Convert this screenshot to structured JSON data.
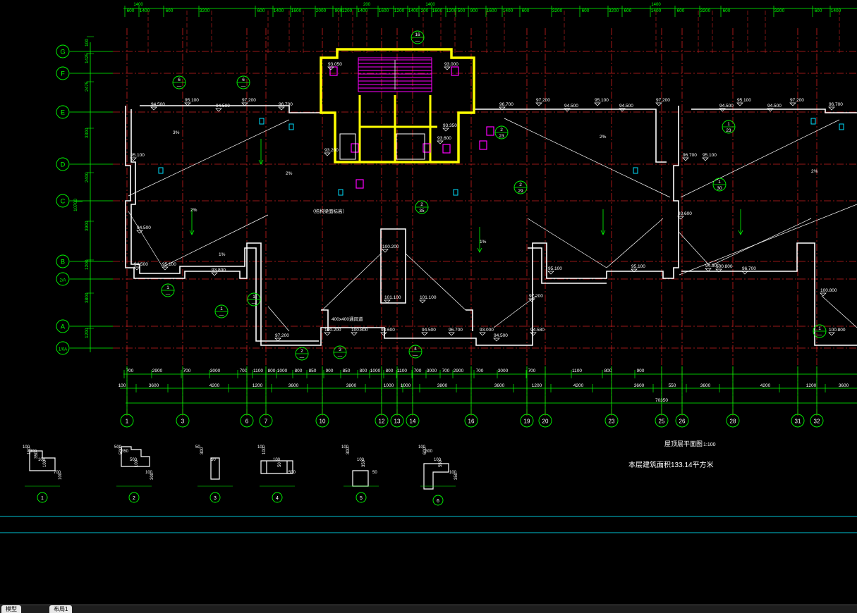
{
  "drawing": {
    "plan_title": "屋顶层平面图",
    "plan_scale": "1:100",
    "area_note": "本层建筑面积133.14平方米",
    "top_dims": [
      "600",
      "1400",
      "600",
      "3200",
      "600",
      "1400",
      "1600",
      "2000",
      "900",
      "1200",
      "1400",
      "1600",
      "1200",
      "1400",
      "200",
      "1600",
      "1200",
      "500",
      "900",
      "1600",
      "1400",
      "600",
      "3200",
      "600",
      "3200",
      "600",
      "1400",
      "600",
      "3200",
      "600",
      "3200",
      "600",
      "1400"
    ],
    "top_header_dims": [
      "1400",
      "200",
      "1400",
      "1400"
    ],
    "bottom_dims_1": [
      "700",
      "2900",
      "700",
      "3000",
      "700",
      "1100",
      "800",
      "1000",
      "800",
      "850",
      "900",
      "850",
      "800",
      "1000",
      "800",
      "1100",
      "700",
      "3000",
      "700",
      "2900",
      "700",
      "3000",
      "700",
      "1100",
      "800",
      "900"
    ],
    "bottom_dims_2": [
      "100",
      "3600",
      "4200",
      "1200",
      "3600",
      "3800",
      "1000",
      "1000",
      "3800",
      "3600",
      "1200",
      "4200",
      "3600",
      "550",
      "3600",
      "4200",
      "1200",
      "3600"
    ],
    "overall_dim": "70350",
    "col_axes": [
      "1",
      "3",
      "6",
      "7",
      "10",
      "12",
      "13",
      "14",
      "16",
      "19",
      "20",
      "23",
      "25",
      "26",
      "28",
      "31",
      "32"
    ],
    "row_axes": [
      "G",
      "F",
      "E",
      "D",
      "C",
      "B",
      "2/A",
      "A",
      "1/0A"
    ],
    "row_dims": [
      "100",
      "1425",
      "2475",
      "3300",
      "2400",
      "3900",
      "1200",
      "3800",
      "1200",
      "10700"
    ],
    "elevations": [
      "94.500",
      "95.100",
      "94.500",
      "97.200",
      "96.700",
      "95.100",
      "94.500",
      "95.100",
      "93.800",
      "93.050",
      "93.000",
      "93.350",
      "93.600",
      "93.200",
      "96.700",
      "97.200",
      "94.500",
      "95.100",
      "94.500",
      "97.200",
      "96.700",
      "95.100",
      "94.500",
      "95.100",
      "94.500",
      "96.700",
      "97.200",
      "94.500",
      "95.100",
      "96.700",
      "97.200",
      "94.580",
      "100.800",
      "100.800",
      "100.800",
      "100.200",
      "101.100",
      "101.100",
      "100.200",
      "100.800",
      "93.600",
      "94.500",
      "96.700",
      "93.000",
      "93.600"
    ],
    "notes": [
      "（结构梁面标高）",
      "2%",
      "1%",
      "400x400通风道",
      "2%",
      "1%",
      "3%",
      "2%",
      "2%"
    ],
    "detail_refs": [
      {
        "num": "6",
        "sheet": "—"
      },
      {
        "num": "6",
        "sheet": "—"
      },
      {
        "num": "1",
        "sheet": "—"
      },
      {
        "num": "1",
        "sheet": "—"
      },
      {
        "num": "1",
        "sheet": "—"
      },
      {
        "num": "2",
        "sheet": "—"
      },
      {
        "num": "3",
        "sheet": "—"
      },
      {
        "num": "4",
        "sheet": "—"
      },
      {
        "num": "2",
        "sheet": "23"
      },
      {
        "num": "2",
        "sheet": "29"
      },
      {
        "num": "2",
        "sheet": "35"
      },
      {
        "num": "16",
        "sheet": "—"
      },
      {
        "num": "1",
        "sheet": "23"
      },
      {
        "num": "1",
        "sheet": "30"
      },
      {
        "num": "1",
        "sheet": "—"
      }
    ],
    "section_labels": [
      "1",
      "2",
      "3",
      "4",
      "5",
      "6"
    ],
    "sec_dims": [
      [
        "100",
        "150",
        "100",
        "100",
        "700",
        "100",
        "300",
        "350"
      ],
      [
        "500",
        "500",
        "500",
        "100",
        "100",
        "300",
        "350"
      ],
      [
        "50",
        "300",
        "50"
      ],
      [
        "100",
        "100",
        "100",
        "50",
        "500"
      ],
      [
        "100",
        "300",
        "100",
        "350",
        "50"
      ],
      [
        "100",
        "600",
        "100",
        "550",
        "100",
        "350",
        "300"
      ]
    ]
  },
  "tabs": [
    "模型",
    "布局1"
  ],
  "colors": {
    "bg": "#000000",
    "grid": "#cc2020",
    "dim": "#00ff00",
    "wall": "#ffffff",
    "stair": "#ff00ff",
    "core": "#ffff00",
    "annot": "#00e0ff"
  }
}
